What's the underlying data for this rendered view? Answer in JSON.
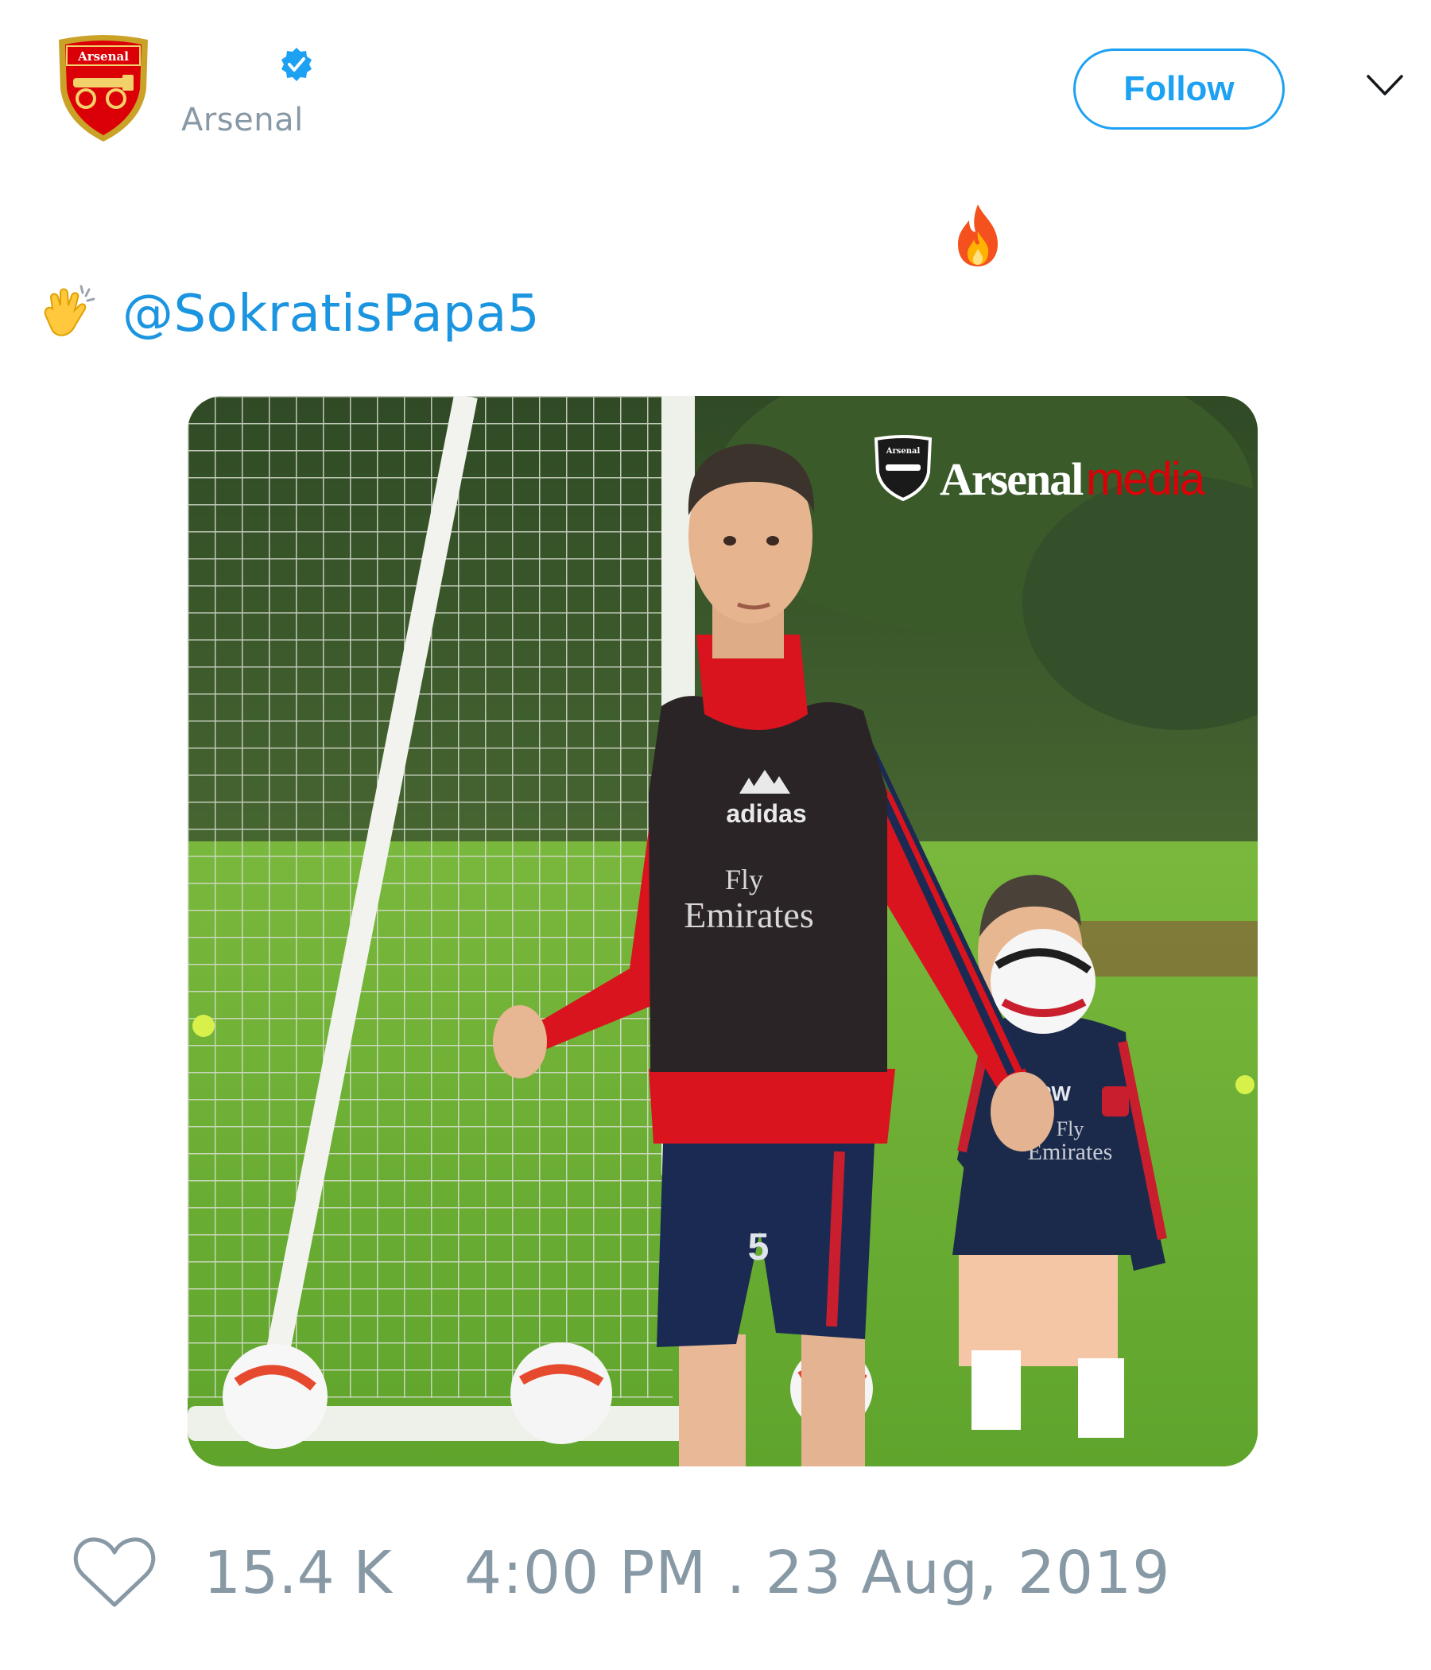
{
  "tweet": {
    "author": {
      "display_name": "",
      "handle": "Arsenal",
      "verified": true,
      "avatar_icon": "arsenal-crest-icon"
    },
    "follow_button": {
      "label": "Follow"
    },
    "menu_icon": "chevron-down-icon",
    "text": {
      "line1_emoji": "fire-emoji",
      "line2_emoji": "clapping-hands-emoji",
      "mention": "@SokratisPapa5"
    },
    "media": {
      "watermark_brand": "Arsenal",
      "watermark_suffix": "media",
      "crest_text": "Arsenal",
      "vest_brand": "adidas",
      "vest_sponsor_line1": "Fly",
      "vest_sponsor_line2": "Emirates",
      "shorts_number": "5",
      "coach_initials": "PW",
      "coach_sponsor_line1": "Fly",
      "coach_sponsor_line2": "Emirates"
    },
    "footer": {
      "like_icon": "heart-icon",
      "likes": "15.4 K",
      "timestamp": "4:00 PM . 23 Aug, 2019"
    }
  },
  "colors": {
    "accent": "#1da1f2",
    "mention": "#1b95e0",
    "muted": "#8899a6",
    "arsenal_red": "#db0007"
  }
}
